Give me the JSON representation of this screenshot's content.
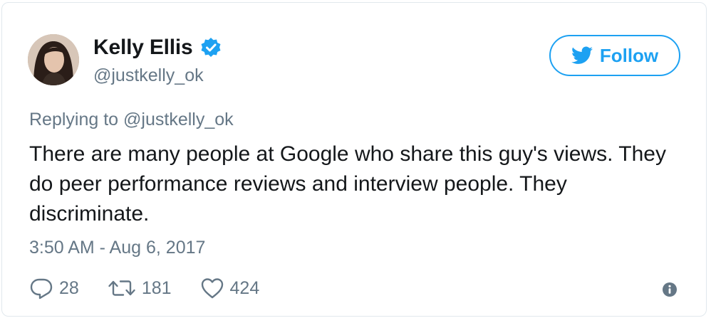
{
  "tweet": {
    "author_name": "Kelly Ellis",
    "author_handle": "@justkelly_ok",
    "verified": true,
    "follow_label": "Follow",
    "replying_prefix": "Replying to",
    "replying_to": "@justkelly_ok",
    "text": "There are many people at Google who share this guy's views. They do peer performance reviews and interview people. They discriminate.",
    "timestamp": "3:50 AM - Aug 6, 2017",
    "replies": "28",
    "retweets": "181",
    "likes": "424"
  },
  "icons": {
    "verified": "verified-badge-icon",
    "follow": "twitter-bird-icon",
    "reply": "reply-icon",
    "retweet": "retweet-icon",
    "like": "heart-icon",
    "info": "info-icon"
  },
  "colors": {
    "accent": "#1da1f2",
    "muted": "#657786",
    "text": "#14171a",
    "border": "#e1e8ed"
  }
}
